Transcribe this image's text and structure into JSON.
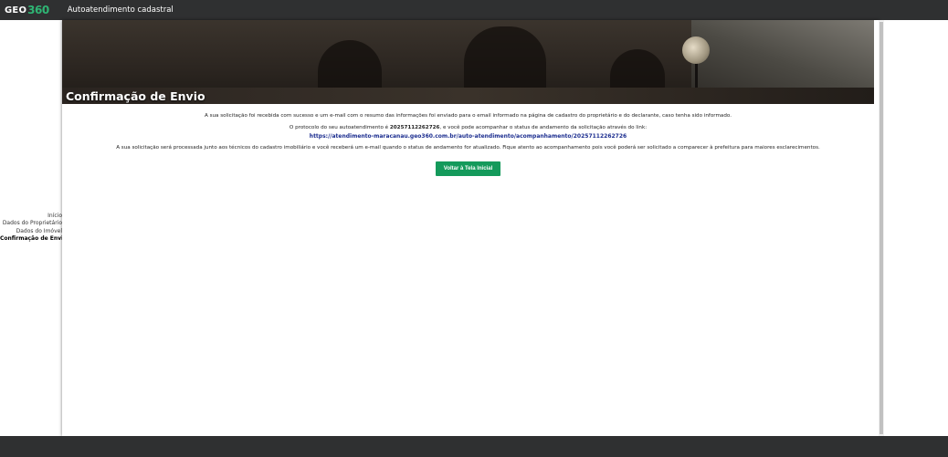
{
  "header": {
    "logo_text": "GEO",
    "logo_number": "360",
    "app_title": "Autoatendimento cadastral"
  },
  "sidebar": {
    "items": [
      {
        "label": "Início"
      },
      {
        "label": "Dados do Proprietário"
      },
      {
        "label": "Dados do Imóvel"
      },
      {
        "label": "Confirmação de Envio"
      }
    ]
  },
  "banner": {
    "title": "Confirmação de Envio"
  },
  "content": {
    "line1": "A sua solicitação foi recebida com sucesso e um e-mail com o resumo das informações foi enviado para o email informado na página de cadastro do proprietário e do declarante, caso tenha sido informado.",
    "line2_prefix": "O protocolo do seu autoatendimento é ",
    "protocol": "20257112262726",
    "line2_suffix": ", e você pode acompanhar o status de andamento da solicitação através do link:",
    "link": "https://atendimento-maracanau.geo360.com.br/auto-atendimento/acompanhamento/20257112262726",
    "line3": "A sua solicitação será processada junto aos técnicos do cadastro imobiliário e você receberá um e-mail quando o status de andamento for atualizado. Fique atento ao acompanhamento pois você poderá ser solicitado a comparecer à prefeitura para maiores esclarecimentos.",
    "back_button": "Voltar à Tela Inicial"
  }
}
